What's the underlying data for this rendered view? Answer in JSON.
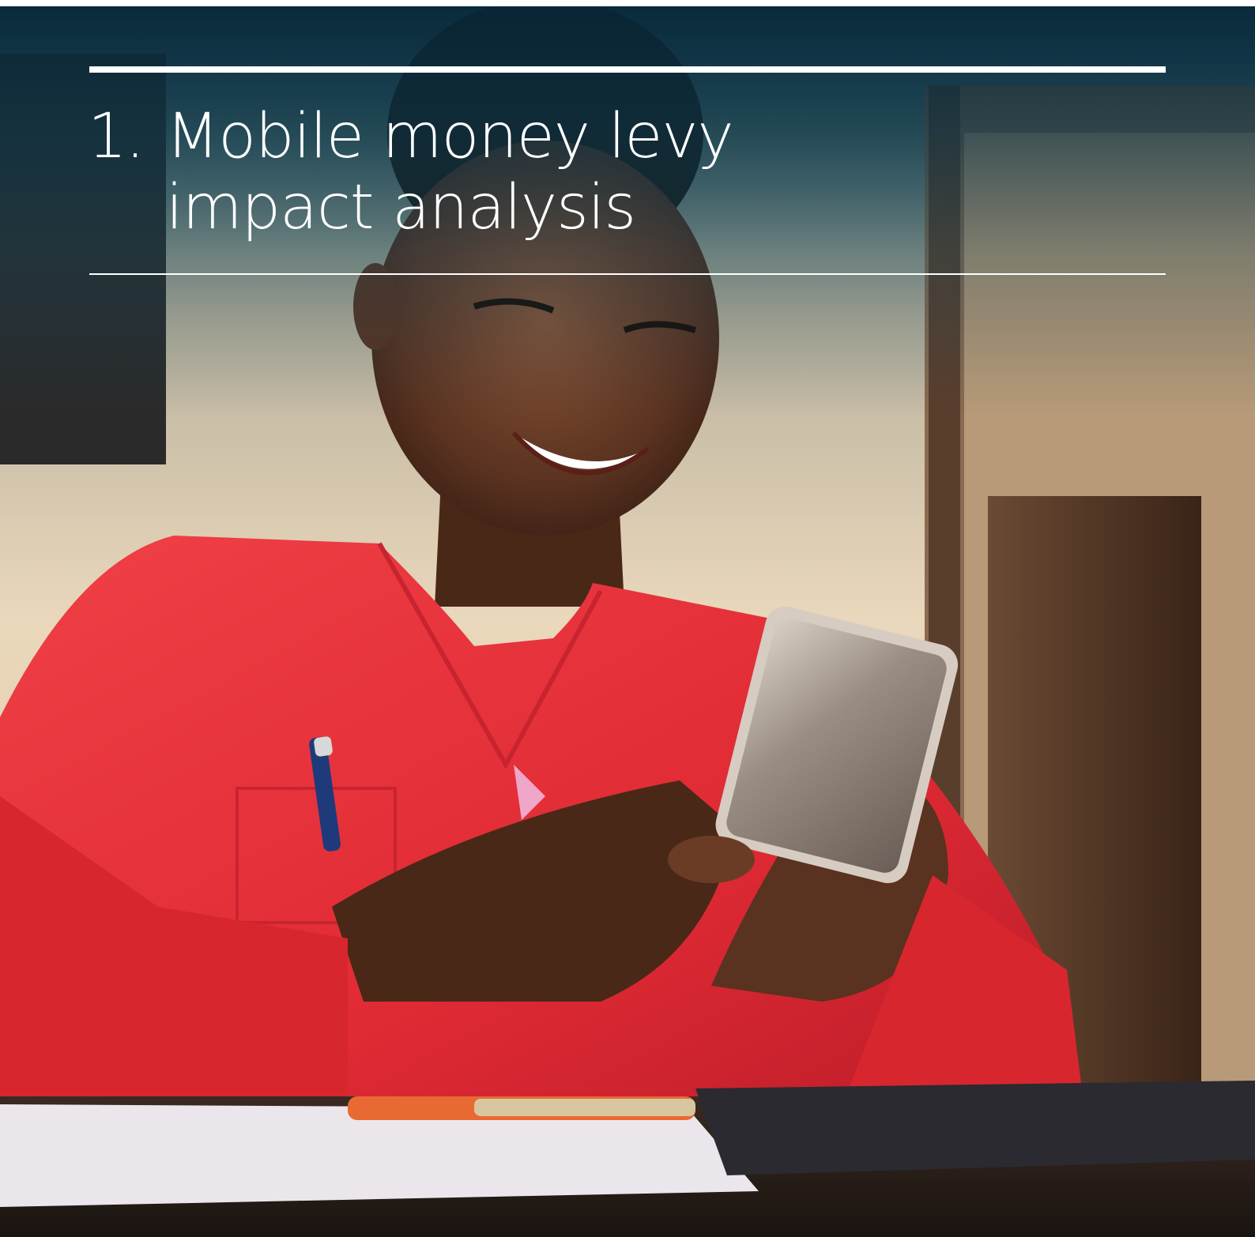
{
  "section": {
    "number": "1.",
    "title_line_1": "Mobile money levy",
    "title_line_2": "impact analysis"
  },
  "photo": {
    "subject": "woman-using-smartphone",
    "colors": {
      "overlay": "#0c3446",
      "shirt": "#e8323a",
      "wall": "#e8d4b8"
    }
  }
}
